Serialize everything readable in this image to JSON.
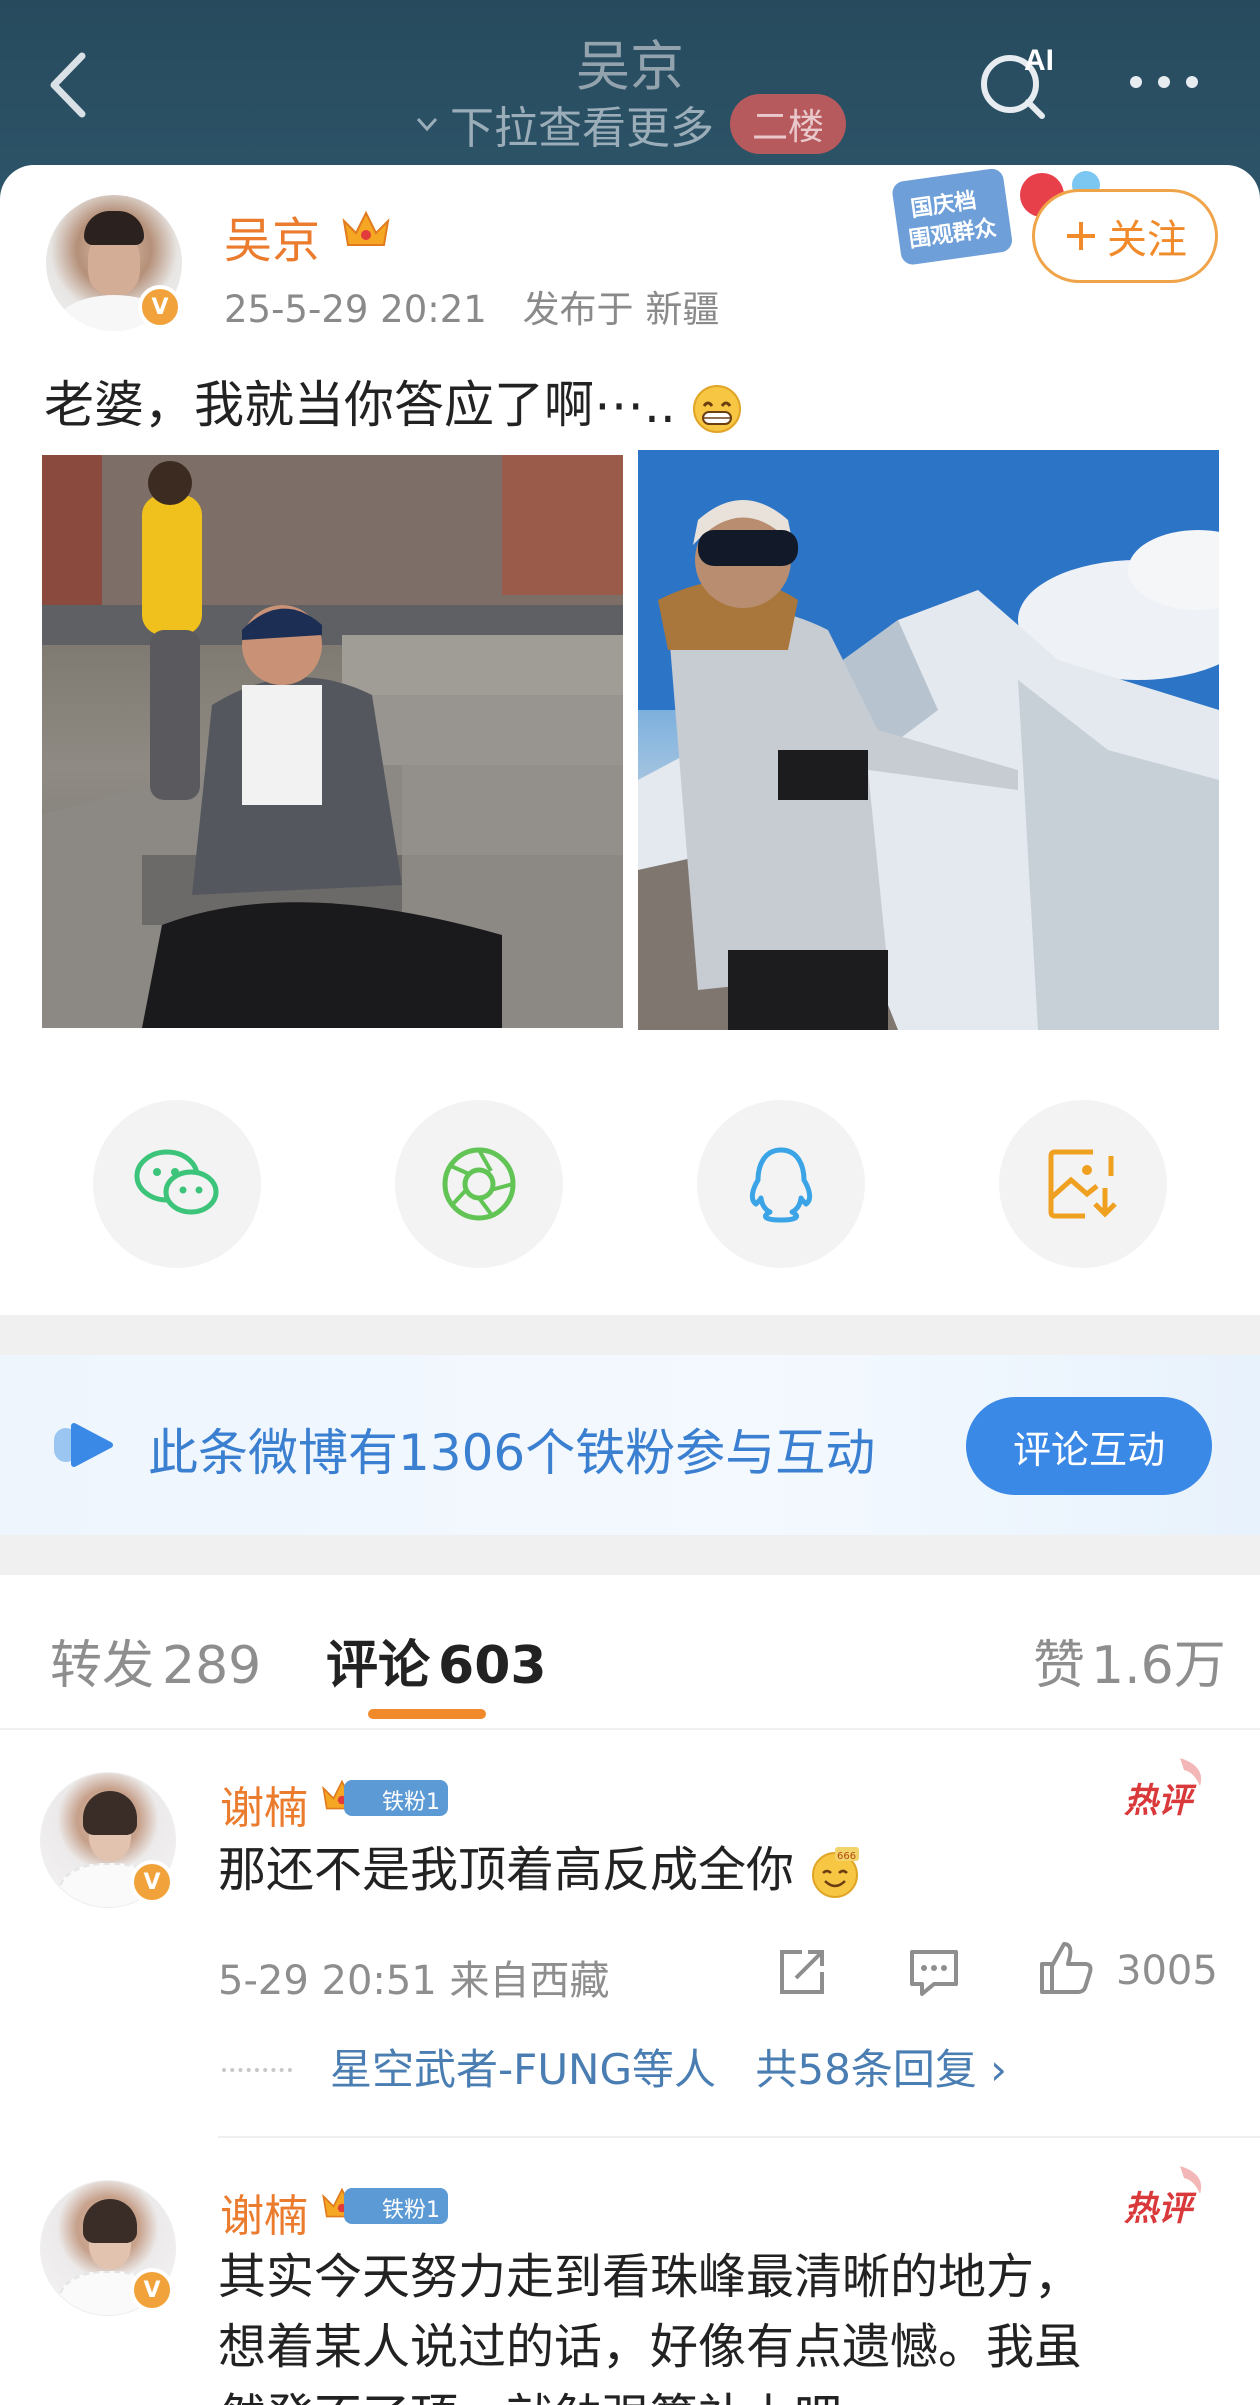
{
  "header": {
    "title": "吴京",
    "pull_hint": "下拉查看更多",
    "floor_badge": "二楼",
    "ai_label": "AI"
  },
  "post": {
    "author": "吴京",
    "verified_badge": "V",
    "time": "25-5-29 20:21",
    "location": "发布于 新疆",
    "follow_label": "关注",
    "event_badge_text": [
      "国庆档",
      "围观群众"
    ],
    "text": "老婆，我就当你答应了啊⋯..",
    "photos": [
      "person-sitting-on-steps",
      "person-in-front-of-snow-mountain"
    ]
  },
  "share": {
    "items": [
      "wechat-icon",
      "moments-icon",
      "qq-icon",
      "save-image-icon"
    ]
  },
  "fan_banner": {
    "text": "此条微博有1306个铁粉参与互动",
    "button": "评论互动"
  },
  "tabs": {
    "repost_label": "转发",
    "repost_count": "289",
    "comment_label": "评论",
    "comment_count": "603",
    "like_label": "赞",
    "like_count": "1.6万"
  },
  "comments": [
    {
      "name": "谢楠",
      "fan_tag": "铁粉1",
      "hot_tag": "热评",
      "text": "那还不是我顶着高反成全你",
      "meta": "5-29 20:51 来自西藏",
      "likes": "3005",
      "reply_users": "星空武者-FUNG等人",
      "reply_count": "共58条回复 ›"
    },
    {
      "name": "谢楠",
      "fan_tag": "铁粉1",
      "hot_tag": "热评",
      "text_line1": "其实今天努力走到看珠峰最清晰的地方，",
      "text_line2": "想着某人说过的话，好像有点遗憾。我虽",
      "text_line3": "然登不了顶，就勉强算补上吧。"
    }
  ],
  "colors": {
    "header_bg": "#2d5469",
    "accent_orange": "#eb7b2d",
    "link_blue": "#3a7fd0",
    "button_blue": "#3b89e6",
    "hot_red": "#d9393b"
  }
}
